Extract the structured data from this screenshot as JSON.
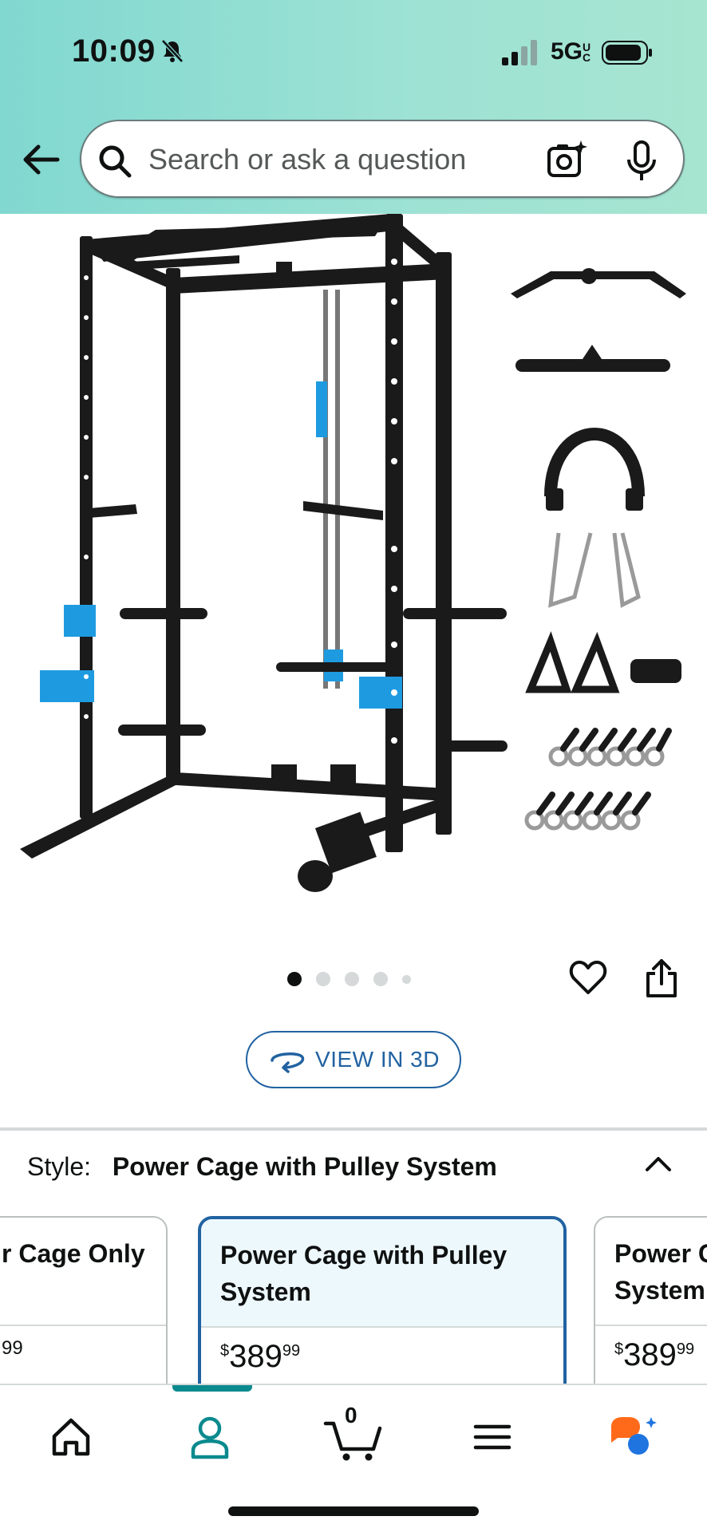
{
  "status_bar": {
    "time": "10:09",
    "network": "5G",
    "network_sub": "UC"
  },
  "search": {
    "placeholder": "Search or ask a question"
  },
  "gallery": {
    "dot_count": 5,
    "active_index": 0
  },
  "actions": {
    "view3d_label": "VIEW IN 3D"
  },
  "style": {
    "label": "Style:",
    "selected": "Power Cage with Pulley System",
    "options": [
      {
        "title": "r Cage Only",
        "price_text": "99"
      },
      {
        "title_line1": "Power Cage with Pulley",
        "title_line2": "System",
        "price_symbol": "$",
        "price_whole": "389",
        "price_fraction": "99"
      },
      {
        "title_line1": "Power C",
        "title_line2": "System",
        "price_symbol": "$",
        "price_whole": "389",
        "price_fraction": "99"
      }
    ]
  },
  "bottom_nav": {
    "cart_count": "0"
  },
  "colors": {
    "accent_blue": "#2162a1",
    "nav_teal": "#0a8a8e",
    "header_from": "#81d8d0",
    "header_to": "#a6e5d0",
    "equipment_blue": "#1e9be0"
  }
}
